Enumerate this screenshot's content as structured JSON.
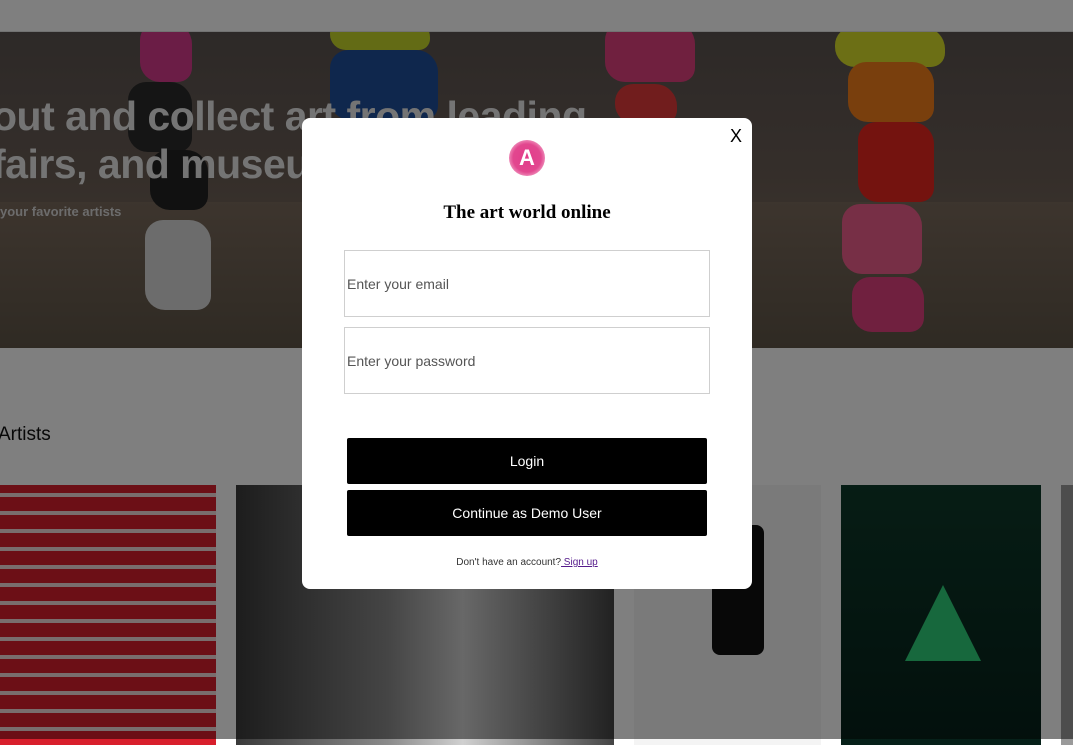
{
  "hero": {
    "headline_line1": "out and collect art from leading",
    "headline_line2": "fairs, and museums",
    "subtitle": "your favorite artists"
  },
  "section": {
    "title": "Artists"
  },
  "modal": {
    "close_label": "X",
    "logo_letter": "A",
    "title": "The art world online",
    "email_placeholder": "Enter your email",
    "password_placeholder": "Enter your password",
    "login_label": "Login",
    "demo_label": "Continue as Demo User",
    "signup_prompt": "Don't have an account?",
    "signup_link": " Sign up"
  },
  "colors": {
    "brand_pink": "#e2478f",
    "button_bg": "#000000",
    "link": "#551a8b"
  }
}
